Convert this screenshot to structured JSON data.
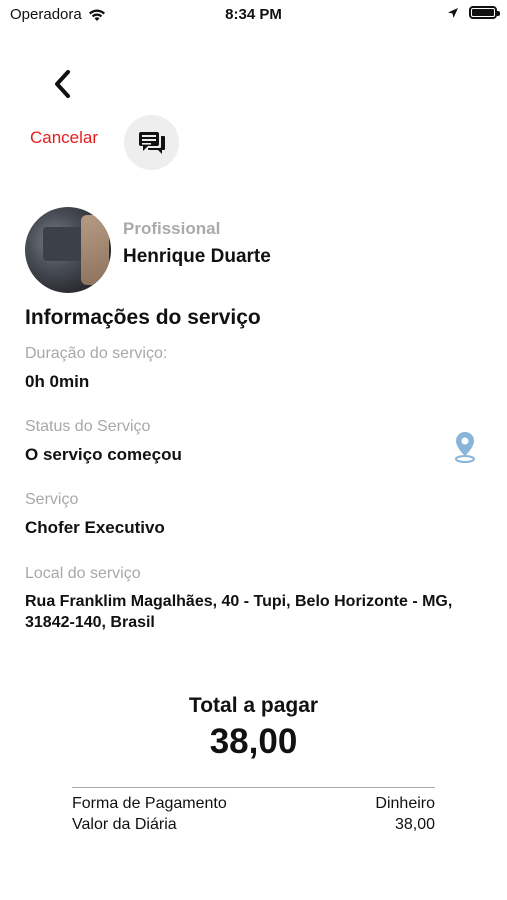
{
  "status_bar": {
    "carrier": "Operadora",
    "time": "8:34 PM",
    "icons": [
      "wifi-icon",
      "location-arrow-icon",
      "battery-icon"
    ]
  },
  "nav": {
    "back_icon": "chevron-left-icon",
    "cancel_label": "Cancelar",
    "chat_icon": "chat-bubbles-icon"
  },
  "professional": {
    "label": "Profissional",
    "name": "Henrique Duarte"
  },
  "service_info": {
    "title": "Informações do serviço",
    "duration_label": "Duração do serviço:",
    "duration_value": "0h 0min",
    "status_label": "Status do Serviço",
    "status_value": "O serviço começou",
    "service_label": "Serviço",
    "service_value": "Chofer Executivo",
    "location_label": "Local do serviço",
    "location_value": "Rua Franklim Magalhães, 40 - Tupi, Belo Horizonte - MG, 31842-140, Brasil",
    "location_icon": "map-pin-icon"
  },
  "payment": {
    "total_label": "Total a pagar",
    "total_value": "38,00",
    "method_label": "Forma de Pagamento",
    "method_value": "Dinheiro",
    "daily_label": "Valor da Diária",
    "daily_value": "38,00"
  },
  "colors": {
    "cancel": "#e81b1b",
    "label_gray": "#a8a8a8",
    "pin_blue": "#8ab4d8"
  }
}
